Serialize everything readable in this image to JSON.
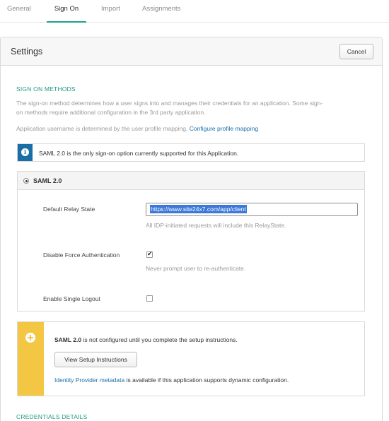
{
  "tabs": [
    {
      "label": "General"
    },
    {
      "label": "Sign On"
    },
    {
      "label": "Import"
    },
    {
      "label": "Assignments"
    }
  ],
  "settings": {
    "title": "Settings",
    "cancel_label": "Cancel"
  },
  "sign_on_methods": {
    "title": "SIGN ON METHODS",
    "desc_line1": "The sign-on method determines how a user signs into and manages their credentials for an application. Some sign-",
    "desc_line2": "on methods require additional configuration in the 3rd party application.",
    "username_text": "Application username is determined by the user profile mapping.",
    "username_link": "Configure profile mapping"
  },
  "info": {
    "icon": "info-icon",
    "text": "SAML 2.0 is the only sign-on option currently supported for this Application."
  },
  "saml": {
    "heading": "SAML 2.0",
    "relay_state_label": "Default Relay State",
    "relay_state_value": "https://www.site24x7.com/app/client",
    "relay_state_hint": "All IDP-initiated requests will include this RelayState.",
    "disable_force_label": "Disable Force Authentication",
    "disable_force_checked": true,
    "disable_force_hint": "Never prompt user to re-authenticate.",
    "single_logout_label": "Enable Single Logout",
    "single_logout_checked": false
  },
  "warning": {
    "icon": "lifebuoy-icon",
    "text_bold": "SAML 2.0",
    "text_rest": "is not configured until you complete the setup instructions.",
    "button_label": "View Setup Instructions",
    "metadata_link": "Identity Provider metadata",
    "metadata_rest": "is available if this application supports dynamic configuration."
  },
  "credentials": {
    "title": "CREDENTIALS DETAILS"
  },
  "colors": {
    "accent": "#1e9a83",
    "link": "#1a6ea8",
    "warning": "#f3c643"
  }
}
